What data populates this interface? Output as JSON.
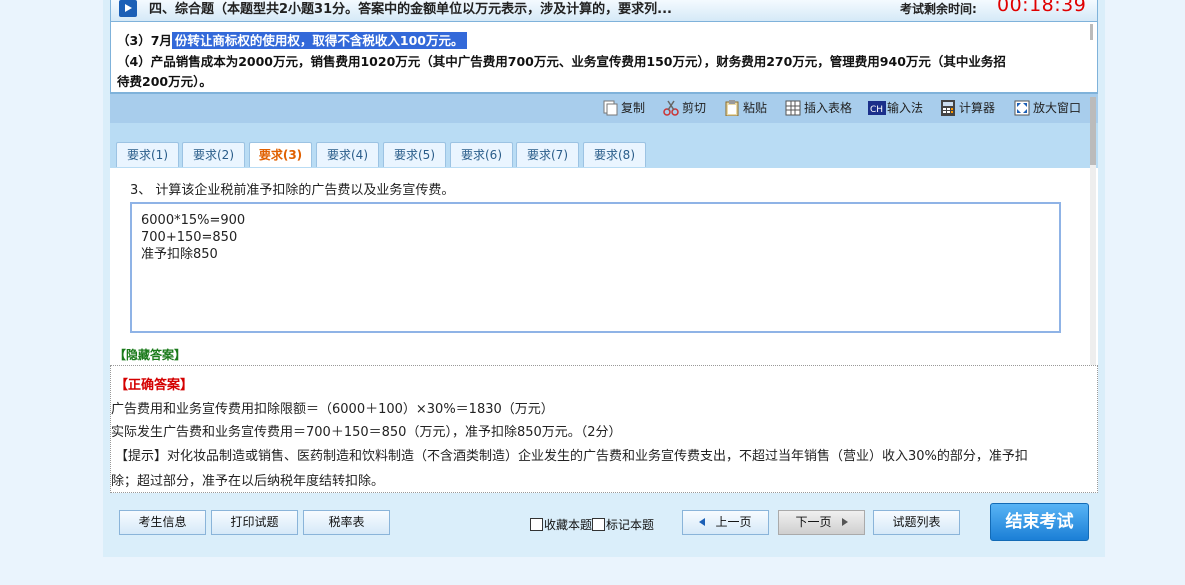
{
  "header": {
    "title": "四、综合题（本题型共2小题31分。答案中的金额单位以万元表示，涉及计算的，要求列...",
    "timer_label": "考试剩余时间:",
    "timer": "00:18:39"
  },
  "question": {
    "line3_prefix": "（3）7月",
    "line3_highlight": "份转让商标权的使用权，取得不含税收入100万元。",
    "line4": "（4）产品销售成本为2000万元，销售费用1020万元（其中广告费用700万元、业务宣传费用150万元），财务费用270万元，管理费用940万元（其中业务招",
    "line4b": "待费200万元）。"
  },
  "toolbar": {
    "copy": "复制",
    "cut": "剪切",
    "paste": "粘贴",
    "insert_table": "插入表格",
    "input_method": "输入法",
    "calculator": "计算器",
    "maximize": "放大窗口"
  },
  "tabs": [
    {
      "label": "要求(1)"
    },
    {
      "label": "要求(2)"
    },
    {
      "label": "要求(3)"
    },
    {
      "label": "要求(4)"
    },
    {
      "label": "要求(5)"
    },
    {
      "label": "要求(6)"
    },
    {
      "label": "要求(7)"
    },
    {
      "label": "要求(8)"
    }
  ],
  "requirement": {
    "text": "3、 计算该企业税前准予扣除的广告费以及业务宣传费。",
    "answer_lines": [
      "6000*15%=900",
      "700+150=850",
      "准予扣除850"
    ]
  },
  "hide_answer": "【隐藏答案】",
  "answer": {
    "correct_label": "【正确答案】",
    "line1": "广告费用和业务宣传费用扣除限额＝（6000＋100）×30%＝1830（万元）",
    "line2": "实际发生广告费和业务宣传费用＝700＋150＝850（万元），准予扣除850万元。（2分）",
    "line3": "【提示】对化妆品制造或销售、医药制造和饮料制造（不含酒类制造）企业发生的广告费和业务宣传费支出，不超过当年销售（营业）收入30%的部分，准予扣",
    "line4": "除；超过部分，准予在以后纳税年度结转扣除。"
  },
  "footer": {
    "student_info": "考生信息",
    "print": "打印试题",
    "tax_table": "税率表",
    "bookmark": "收藏本题",
    "mark": "标记本题",
    "prev": "上一页",
    "next": "下一页",
    "list": "试题列表",
    "end": "结束考试"
  }
}
